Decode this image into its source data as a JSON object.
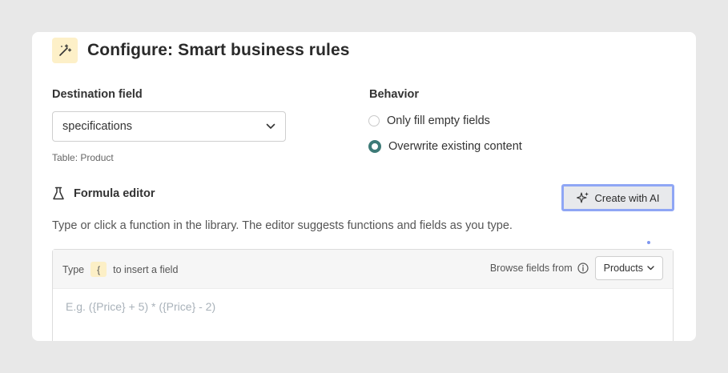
{
  "header": {
    "title": "Configure: Smart business rules",
    "icon": "magic-wand-icon"
  },
  "destination": {
    "label": "Destination field",
    "selected_value": "specifications",
    "hint": "Table: Product"
  },
  "behavior": {
    "label": "Behavior",
    "options": [
      {
        "label": "Only fill empty fields",
        "checked": false
      },
      {
        "label": "Overwrite existing content",
        "checked": true
      }
    ]
  },
  "formula": {
    "label": "Formula editor",
    "icon": "flask-icon",
    "ai_button_label": "Create with AI",
    "description": "Type or click a function in the library. The editor suggests functions and fields as you type.",
    "toolbar": {
      "type_prefix": "Type",
      "brace": "{",
      "type_suffix": "to insert a field",
      "browse_label": "Browse fields from",
      "browse_value": "Products"
    },
    "placeholder": "E.g. ({Price} + 5) * ({Price} - 2)"
  },
  "colors": {
    "accent": "#3d7a77",
    "ai_outline": "#8fa6f5",
    "icon_bg": "#fdf0c8"
  }
}
